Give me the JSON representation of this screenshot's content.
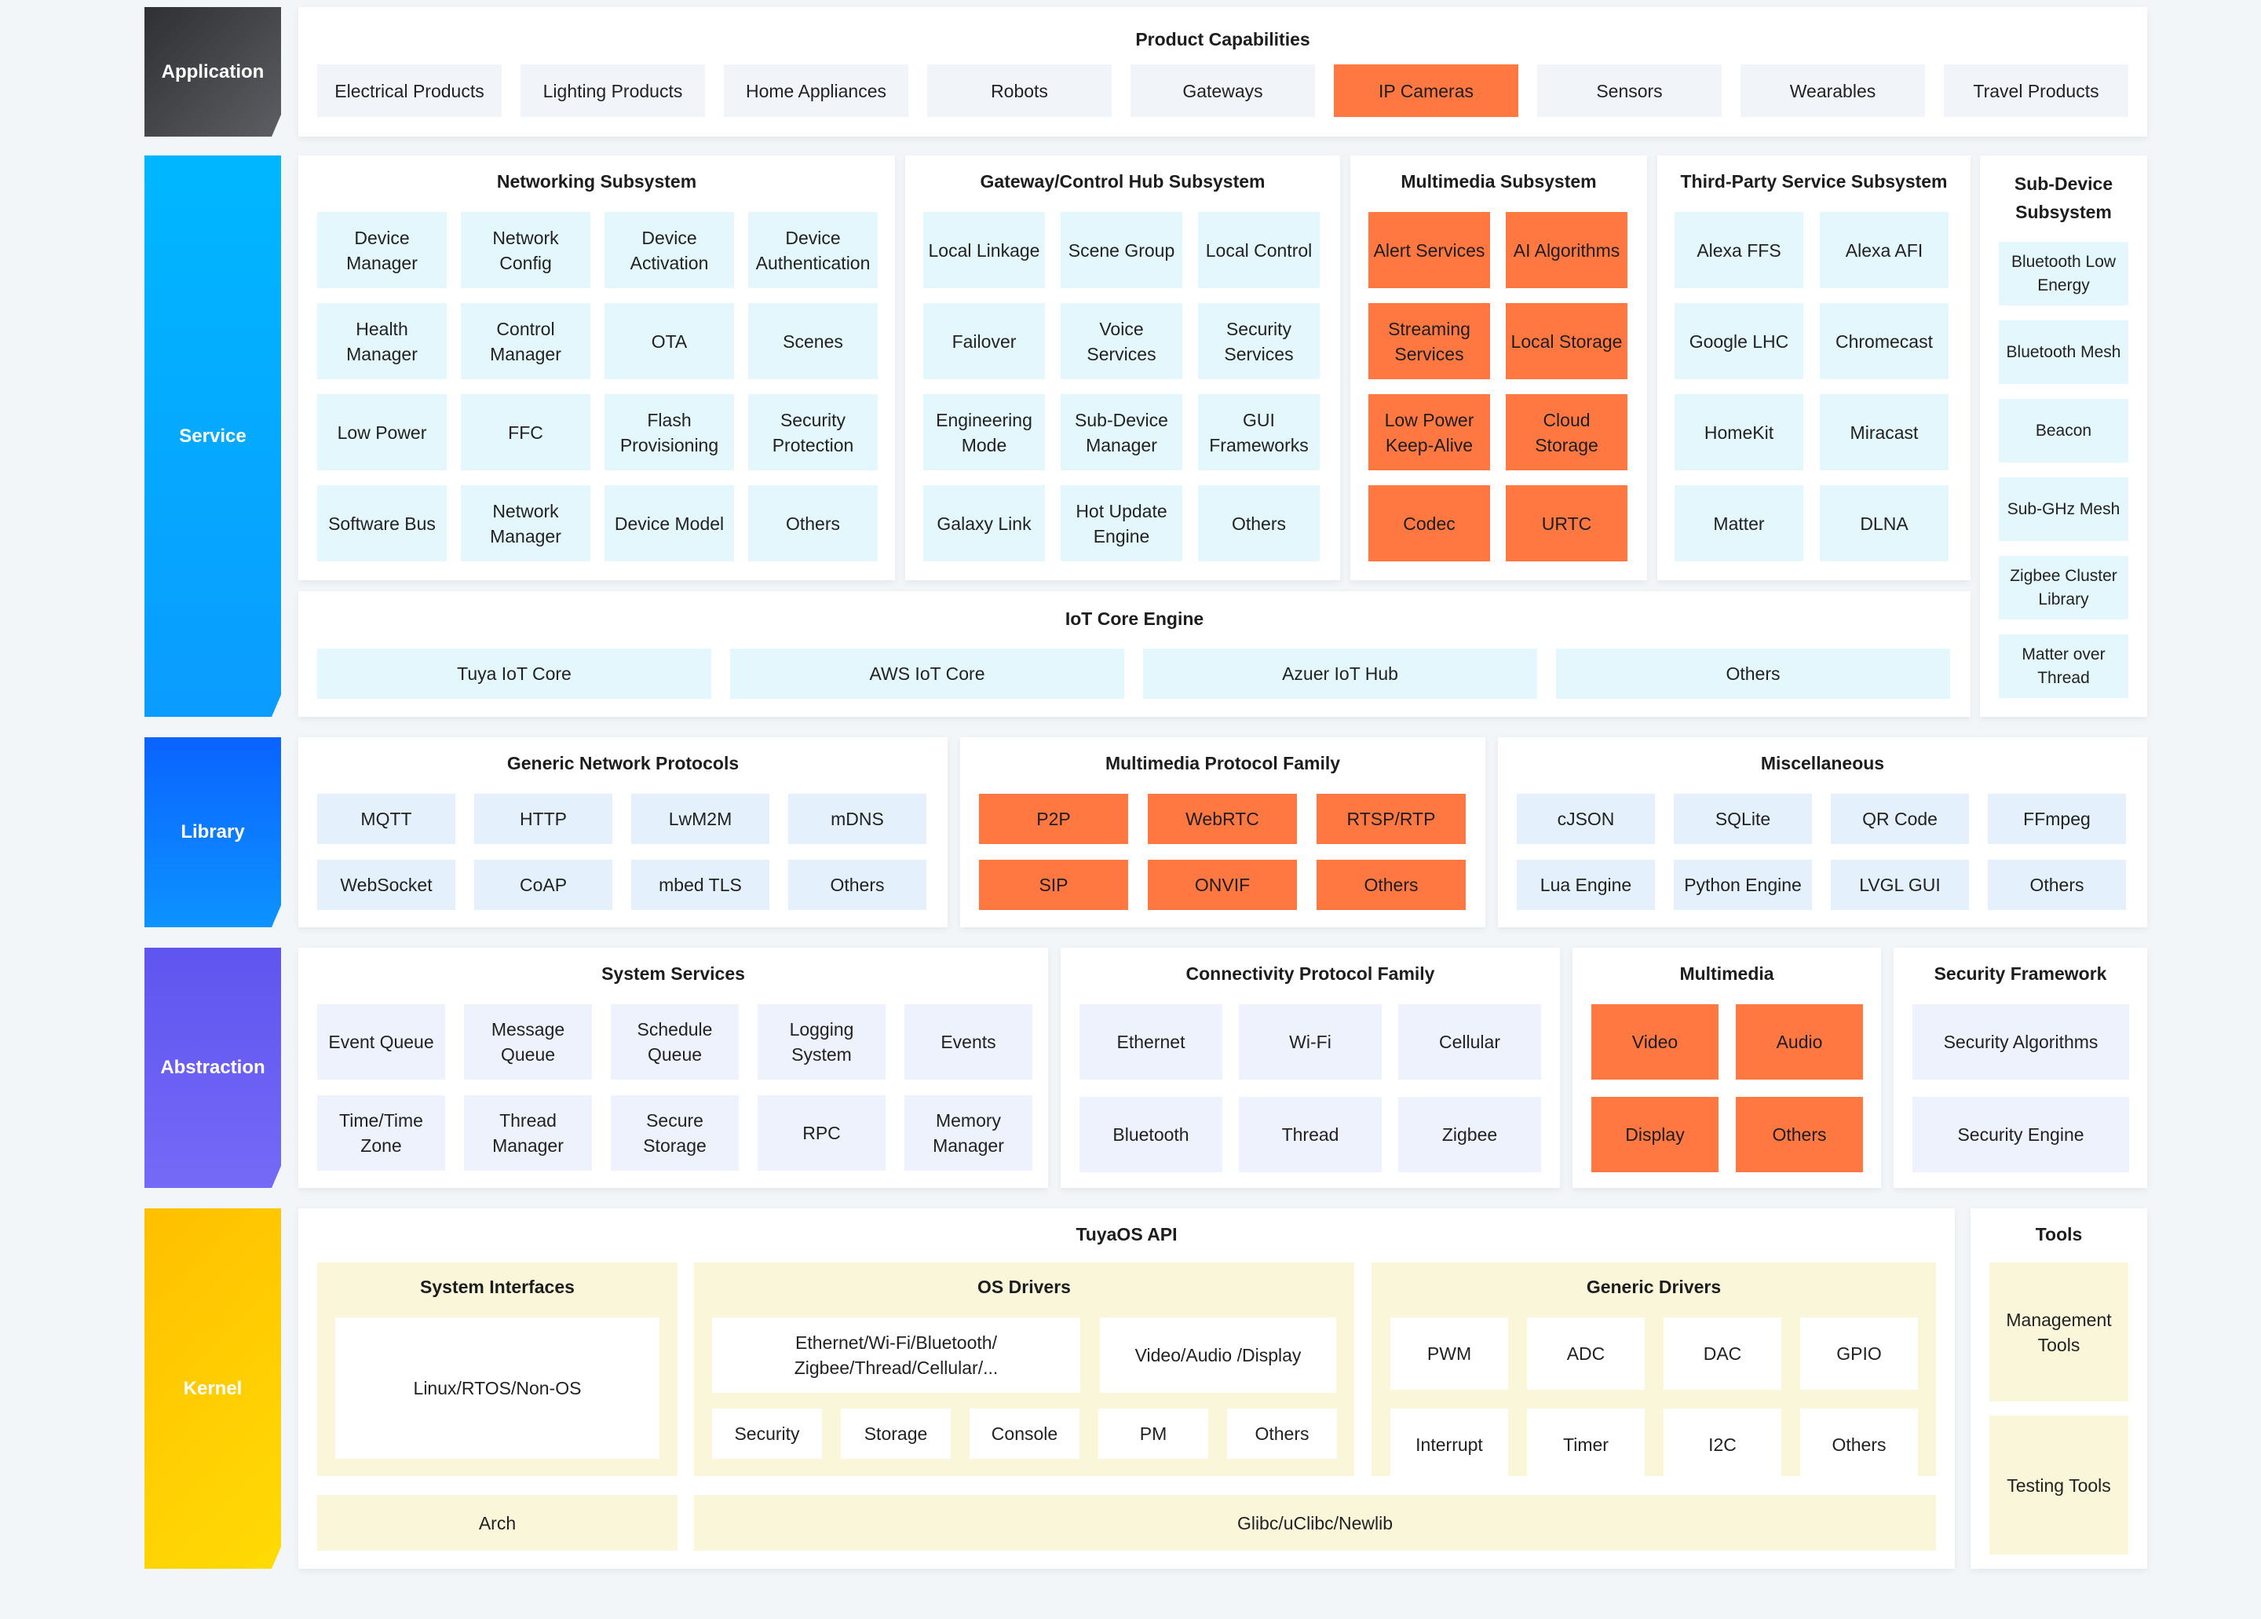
{
  "colors": {
    "highlight": "#ff7842",
    "application_label": "#3d3f44",
    "service_label": "#00b0ff",
    "library_label": "#0a6cff",
    "abstraction_label": "#6a5cf0",
    "kernel_label": "#ffc400"
  },
  "layers": {
    "application": "Application",
    "service": "Service",
    "library": "Library",
    "abstraction": "Abstraction",
    "kernel": "Kernel"
  },
  "application": {
    "title": "Product Capabilities",
    "products": [
      {
        "label": "Electrical Products",
        "highlight": false
      },
      {
        "label": "Lighting Products",
        "highlight": false
      },
      {
        "label": "Home Appliances",
        "highlight": false
      },
      {
        "label": "Robots",
        "highlight": false
      },
      {
        "label": "Gateways",
        "highlight": false
      },
      {
        "label": "IP Cameras",
        "highlight": true
      },
      {
        "label": "Sensors",
        "highlight": false
      },
      {
        "label": "Wearables",
        "highlight": false
      },
      {
        "label": "Travel Products",
        "highlight": false
      }
    ]
  },
  "service": {
    "networking": {
      "title": "Networking Subsystem",
      "items": [
        "Device Manager",
        "Network Config",
        "Device Activation",
        "Device Authentication",
        "Health Manager",
        "Control Manager",
        "OTA",
        "Scenes",
        "Low Power",
        "FFC",
        "Flash Provisioning",
        "Security Protection",
        "Software Bus",
        "Network Manager",
        "Device Model",
        "Others"
      ]
    },
    "gateway": {
      "title": "Gateway/Control Hub Subsystem",
      "items": [
        "Local Linkage",
        "Scene Group",
        "Local Control",
        "Failover",
        "Voice Services",
        "Security Services",
        "Engineering Mode",
        "Sub-Device Manager",
        "GUI Frameworks",
        "Galaxy Link",
        "Hot Update Engine",
        "Others"
      ]
    },
    "multimedia": {
      "title": "Multimedia Subsystem",
      "items": [
        "Alert Services",
        "AI Algorithms",
        "Streaming Services",
        "Local Storage",
        "Low Power Keep-Alive",
        "Cloud Storage",
        "Codec",
        "URTC"
      ]
    },
    "third_party": {
      "title": "Third-Party Service Subsystem",
      "items": [
        "Alexa FFS",
        "Alexa AFI",
        "Google LHC",
        "Chromecast",
        "HomeKit",
        "Miracast",
        "Matter",
        "DLNA"
      ]
    },
    "sub_device": {
      "title": "Sub-Device Subsystem",
      "items": [
        "Bluetooth Low Energy",
        "Bluetooth Mesh",
        "Beacon",
        "Sub-GHz Mesh",
        "Zigbee Cluster Library",
        "Matter over Thread"
      ]
    },
    "iot_core": {
      "title": "IoT Core Engine",
      "items": [
        "Tuya IoT Core",
        "AWS IoT Core",
        "Azuer IoT Hub",
        "Others"
      ]
    }
  },
  "library": {
    "generic": {
      "title": "Generic Network Protocols",
      "items": [
        "MQTT",
        "HTTP",
        "LwM2M",
        "mDNS",
        "WebSocket",
        "CoAP",
        "mbed TLS",
        "Others"
      ]
    },
    "multimedia": {
      "title": "Multimedia Protocol Family",
      "items": [
        "P2P",
        "WebRTC",
        "RTSP/RTP",
        "SIP",
        "ONVIF",
        "Others"
      ]
    },
    "misc": {
      "title": "Miscellaneous",
      "items": [
        "cJSON",
        "SQLite",
        "QR Code",
        "FFmpeg",
        "Lua Engine",
        "Python Engine",
        "LVGL GUI",
        "Others"
      ]
    }
  },
  "abstraction": {
    "system": {
      "title": "System Services",
      "items": [
        "Event Queue",
        "Message Queue",
        "Schedule Queue",
        "Logging System",
        "Events",
        "Time/Time Zone",
        "Thread Manager",
        "Secure Storage",
        "RPC",
        "Memory Manager"
      ]
    },
    "connectivity": {
      "title": "Connectivity Protocol Family",
      "items": [
        "Ethernet",
        "Wi-Fi",
        "Cellular",
        "Bluetooth",
        "Thread",
        "Zigbee"
      ]
    },
    "multimedia": {
      "title": "Multimedia",
      "items": [
        "Video",
        "Audio",
        "Display",
        "Others"
      ]
    },
    "security": {
      "title": "Security Framework",
      "items": [
        "Security Algorithms",
        "Security Engine"
      ]
    }
  },
  "kernel": {
    "api_title": "TuyaOS API",
    "system_interfaces": {
      "title": "System Interfaces",
      "item": "Linux/RTOS/Non-OS"
    },
    "os_drivers": {
      "title": "OS Drivers",
      "wide_items": [
        "Ethernet/Wi-Fi/Bluetooth/ Zigbee/Thread/Cellular/...",
        "Video/Audio /Display"
      ],
      "items": [
        "Security",
        "Storage",
        "Console",
        "PM",
        "Others"
      ]
    },
    "generic_drivers": {
      "title": "Generic Drivers",
      "items": [
        "PWM",
        "ADC",
        "DAC",
        "GPIO",
        "Interrupt",
        "Timer",
        "I2C",
        "Others"
      ]
    },
    "arch": "Arch",
    "libc": "Glibc/uClibc/Newlib",
    "tools": {
      "title": "Tools",
      "items": [
        "Management Tools",
        "Testing Tools"
      ]
    }
  }
}
